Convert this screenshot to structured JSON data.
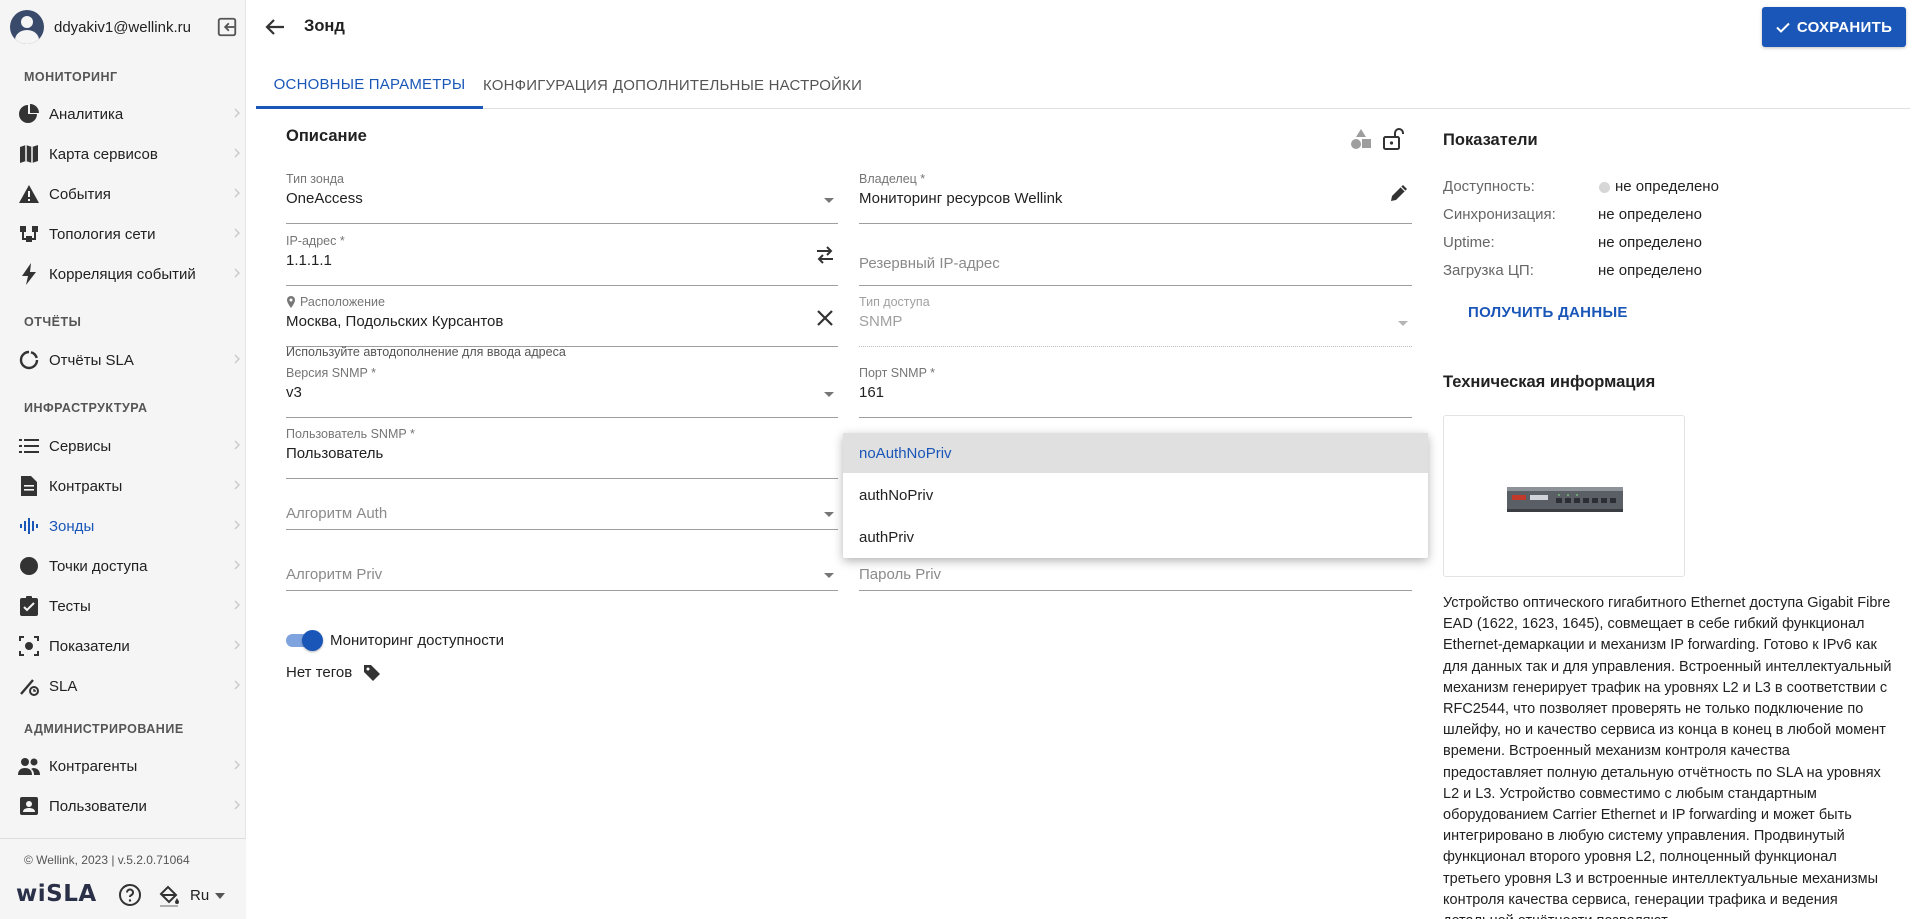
{
  "user": {
    "email": "ddyakiv1@wellink.ru"
  },
  "sidebar": {
    "sections": [
      {
        "title": "МОНИТОРИНГ",
        "items": [
          {
            "label": "Аналитика",
            "icon": "pie-chart-icon"
          },
          {
            "label": "Карта сервисов",
            "icon": "map-icon"
          },
          {
            "label": "События",
            "icon": "warning-icon"
          },
          {
            "label": "Топология сети",
            "icon": "topology-icon"
          },
          {
            "label": "Корреляция событий",
            "icon": "bolt-icon"
          }
        ]
      },
      {
        "title": "ОТЧЁТЫ",
        "items": [
          {
            "label": "Отчёты SLA",
            "icon": "sla-report-icon"
          }
        ]
      },
      {
        "title": "ИНФРАСТРУКТУРА",
        "items": [
          {
            "label": "Сервисы",
            "icon": "list-icon"
          },
          {
            "label": "Контракты",
            "icon": "document-icon"
          },
          {
            "label": "Зонды",
            "icon": "probe-icon",
            "active": true
          },
          {
            "label": "Точки доступа",
            "icon": "circle-icon"
          },
          {
            "label": "Тесты",
            "icon": "checklist-icon"
          },
          {
            "label": "Показатели",
            "icon": "metrics-icon"
          },
          {
            "label": "SLA",
            "icon": "sla-icon"
          }
        ]
      },
      {
        "title": "АДМИНИСТРИРОВАНИЕ",
        "items": [
          {
            "label": "Контрагенты",
            "icon": "people-icon"
          },
          {
            "label": "Пользователи",
            "icon": "user-badge-icon"
          }
        ]
      }
    ],
    "footer": {
      "copyright": "© Wellink, 2023 | v.5.2.0.71064",
      "brand": "wiSLA",
      "language": "Ru"
    }
  },
  "header": {
    "title": "Зонд",
    "save_label": "СОХРАНИТЬ"
  },
  "tabs": [
    {
      "label": "ОСНОВНЫЕ ПАРАМЕТРЫ",
      "active": true
    },
    {
      "label": "КОНФИГУРАЦИЯ",
      "active": false
    },
    {
      "label": "ДОПОЛНИТЕЛЬНЫЕ НАСТРОЙКИ",
      "active": false
    }
  ],
  "form": {
    "title": "Описание",
    "probe_type": {
      "label": "Тип зонда",
      "value": "OneAccess"
    },
    "owner": {
      "label": "Владелец *",
      "value": "Мониторинг ресурсов Wellink"
    },
    "ip": {
      "label": "IP-адрес *",
      "value": "1.1.1.1"
    },
    "backup_ip": {
      "placeholder": "Резервный IP-адрес"
    },
    "location": {
      "label": "Расположение",
      "value": "Москва, Подольских Курсантов",
      "helper": "Используйте автодополнение для ввода адреса"
    },
    "access_type": {
      "label": "Тип доступа",
      "value": "SNMP"
    },
    "snmp_version": {
      "label": "Версия SNMP *",
      "value": "v3"
    },
    "snmp_port": {
      "label": "Порт SNMP *",
      "value": "161"
    },
    "snmp_user": {
      "label": "Пользователь SNMP *",
      "value": "Пользователь"
    },
    "auth_algo": {
      "placeholder": "Алгоритм Auth"
    },
    "priv_algo": {
      "placeholder": "Алгоритм Priv"
    },
    "priv_password": {
      "placeholder": "Пароль Priv"
    },
    "security_level_options": [
      "noAuthNoPriv",
      "authNoPriv",
      "authPriv"
    ],
    "security_level_selected": "noAuthNoPriv",
    "availability_monitoring": {
      "label": "Мониторинг доступности",
      "on": true
    },
    "tags": "Нет тегов"
  },
  "metrics": {
    "title": "Показатели",
    "rows": [
      {
        "label": "Доступность:",
        "value": "не определено",
        "dot": true
      },
      {
        "label": "Синхронизация:",
        "value": "не определено"
      },
      {
        "label": "Uptime:",
        "value": "не определено"
      },
      {
        "label": "Загрузка ЦП:",
        "value": "не определено"
      }
    ],
    "fetch_label": "ПОЛУЧИТЬ ДАННЫЕ"
  },
  "tech_info": {
    "title": "Техническая информация",
    "description": "Устройство оптического гигабитного Ethernet доступа Gigabit Fibre EAD (1622, 1623, 1645), совмещает в себе гибкий функционал Ethernet-демаркации и механизм IP forwarding. Готово к IPv6 как для данных так и для управления. Встроенный интеллектуальный механизм генерирует трафик на уровнях L2 и L3 в соответствии с RFC2544, что позволяет проверять не только подключение по шлейфу, но и качество сервиса из конца в конец в любой момент времени. Встроенный механизм контроля качества предоставляет полную детальную отчётность по SLA на уровнях L2 и L3. Устройство совместимо с любым стандартным оборудованием Carrier Ethernet и IP forwarding и может быть интегрировано в любую систему управления. Продвинутый функционал второго уровня L2, полноценный функционал третьего уровня L3 и встроенные интеллектуальные механизмы контроля качества сервиса, генерации трафика и ведения детальной отчётности позволяют"
  }
}
